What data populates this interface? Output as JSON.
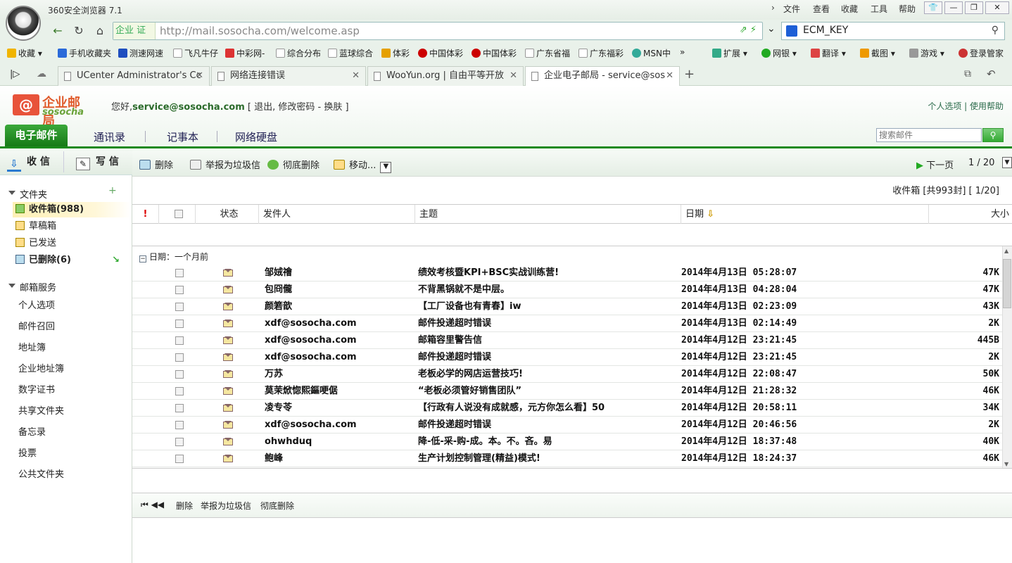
{
  "browser": {
    "app_title": "360安全浏览器 7.1",
    "menus": [
      "文件",
      "查看",
      "收藏",
      "工具",
      "帮助"
    ],
    "url_badge": "企业 证",
    "url": "http://mail.sosocha.com/welcome.asp",
    "search_value": "ECM_KEY",
    "bookmarks": [
      "收藏",
      "手机收藏夹",
      "测速网速",
      "飞凡牛仔",
      "中彩网-",
      "综合分布",
      "蓝球综合",
      "体彩",
      "中国体彩",
      "中国体彩",
      "广东省福",
      "广东福彩",
      "MSN中"
    ],
    "bookmark_tools": [
      "扩展",
      "网银",
      "翻译",
      "截图",
      "游戏",
      "登录管家"
    ],
    "tabs": [
      {
        "label": "UCenter Administrator's Cc"
      },
      {
        "label": "网络连接错误"
      },
      {
        "label": "WooYun.org | 自由平等开放"
      },
      {
        "label": "企业电子邮局 - service@sos"
      }
    ]
  },
  "mail": {
    "brand_cn": "企业邮局",
    "brand_en": "sosocha",
    "greeting_prefix": "您好,",
    "user_email": "service@sosocha.com",
    "greeting_links": "[ 退出, 修改密码 - 换肤 ]",
    "top_links": "个人选项 | 使用帮助",
    "nav_tabs": [
      "电子邮件",
      "通讯录",
      "记事本",
      "网络硬盘"
    ],
    "search_placeholder": "搜索邮件",
    "sidebar": {
      "receive": "收 信",
      "compose": "写 信",
      "folders_title": "文件夹",
      "folders": [
        "收件箱(988)",
        "草稿箱",
        "已发送",
        "已删除(6)"
      ],
      "services_title": "邮箱服务",
      "services": [
        "个人选项",
        "邮件召回",
        "地址簿",
        "企业地址簿",
        "数字证书",
        "共享文件夹",
        "备忘录",
        "投票",
        "公共文件夹"
      ]
    },
    "toolbar": {
      "delete": "删除",
      "report_spam": "举报为垃圾信",
      "delete_perm": "彻底删除",
      "move": "移动...",
      "next_page": "下一页",
      "page": "1 / 20"
    },
    "status": "收件箱 [共993封]  [ 1/20]",
    "columns": [
      "!",
      "",
      "状态",
      "发件人",
      "主题",
      "日期",
      "大小"
    ],
    "group_label": "日期：一个月前",
    "emails": [
      {
        "from": "邹娀禬",
        "subject": "绩效考核暨KPI+BSC实战训练营!",
        "date": "2014年4月13日 05:28:07",
        "size": "47K"
      },
      {
        "from": "包冏儱",
        "subject": "不背黑锅就不是中层。",
        "date": "2014年4月13日 04:28:04",
        "size": "47K"
      },
      {
        "from": "颜箬歆",
        "subject": "【工厂设备也有青春】iw",
        "date": "2014年4月13日 02:23:09",
        "size": "43K"
      },
      {
        "from": "xdf@sosocha.com",
        "subject": "邮件投递超时错误",
        "date": "2014年4月13日 02:14:49",
        "size": "2K"
      },
      {
        "from": "xdf@sosocha.com",
        "subject": "邮箱容里警告信",
        "date": "2014年4月12日 23:21:45",
        "size": "445B"
      },
      {
        "from": "xdf@sosocha.com",
        "subject": "邮件投递超时错误",
        "date": "2014年4月12日 23:21:45",
        "size": "2K"
      },
      {
        "from": "万苏",
        "subject": "老板必学的网店运营技巧!",
        "date": "2014年4月12日 22:08:47",
        "size": "50K"
      },
      {
        "from": "莫茉焮惚熙鏂哽倨",
        "subject": "“老板必须管好销售团队”",
        "date": "2014年4月12日 21:28:32",
        "size": "46K"
      },
      {
        "from": "凌专苓",
        "subject": "【行政有人说没有成就感，元方你怎么看】50",
        "date": "2014年4月12日 20:58:11",
        "size": "34K"
      },
      {
        "from": "xdf@sosocha.com",
        "subject": "邮件投递超时错误",
        "date": "2014年4月12日 20:46:56",
        "size": "2K"
      },
      {
        "from": "ohwhduq",
        "subject": "降-低-采-购-成。本。不。吝。易",
        "date": "2014年4月12日 18:37:48",
        "size": "40K"
      },
      {
        "from": "鲍峰",
        "subject": "生产计划控制管理(精益)模式!",
        "date": "2014年4月12日 18:24:37",
        "size": "46K"
      }
    ],
    "footer": {
      "nav": "⏮ ◀◀",
      "delete": "删除",
      "report_spam": "举报为垃圾信",
      "delete_perm": "彻底删除"
    }
  }
}
